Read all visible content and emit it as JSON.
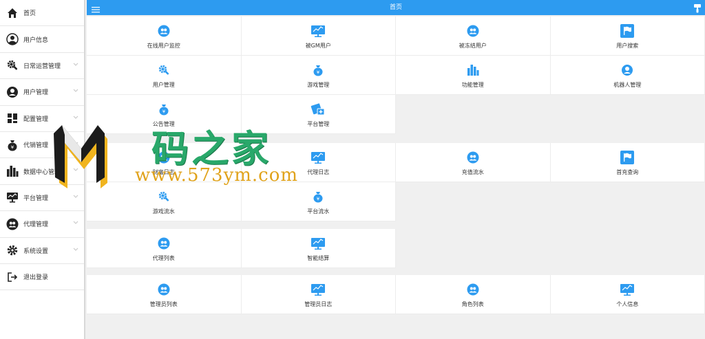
{
  "colors": {
    "accent": "#2d9bf0",
    "icon": "#2d9bf0",
    "watermark_green": "#29a86a",
    "watermark_gold": "#e0a21a"
  },
  "sidebar": {
    "items": [
      {
        "label": "首页",
        "icon": "home-icon",
        "has_arrow": false
      },
      {
        "label": "用户信息",
        "icon": "user-circle-icon",
        "has_arrow": false
      },
      {
        "label": "日常运营管理",
        "icon": "gear-wrench-icon",
        "has_arrow": true
      },
      {
        "label": "用户管理",
        "icon": "user-icon",
        "has_arrow": true
      },
      {
        "label": "配置管理",
        "icon": "grid-icon",
        "has_arrow": true
      },
      {
        "label": "代销管理",
        "icon": "money-bag-icon",
        "has_arrow": true
      },
      {
        "label": "数据中心管理",
        "icon": "bar-chart-icon",
        "has_arrow": true
      },
      {
        "label": "平台管理",
        "icon": "monitor-icon",
        "has_arrow": true
      },
      {
        "label": "代理管理",
        "icon": "users-icon",
        "has_arrow": true
      },
      {
        "label": "系统设置",
        "icon": "gear-icon",
        "has_arrow": true
      },
      {
        "label": "退出登录",
        "icon": "logout-icon",
        "has_arrow": false
      }
    ]
  },
  "header": {
    "title": "首页",
    "menu_icon": "hamburger-icon",
    "right_icon": "brush-icon"
  },
  "panels": [
    {
      "tiles": [
        {
          "label": "在线用户监控",
          "icon": "users-icon"
        },
        {
          "label": "被GM用户",
          "icon": "chart-icon"
        },
        {
          "label": "被冻结用户",
          "icon": "users-icon"
        },
        {
          "label": "用户搜索",
          "icon": "flag-icon"
        },
        {
          "label": "用户管理",
          "icon": "gear-wrench-icon"
        },
        {
          "label": "游戏管理",
          "icon": "money-bag-icon"
        },
        {
          "label": "功能管理",
          "icon": "bar-chart-icon"
        },
        {
          "label": "机器人管理",
          "icon": "user-icon"
        },
        {
          "label": "公告管理",
          "icon": "money-bag-icon"
        },
        {
          "label": "平台管理",
          "icon": "card-icon"
        }
      ]
    },
    {
      "tiles": [
        {
          "label": "财富日志",
          "icon": "users-icon"
        },
        {
          "label": "代理日志",
          "icon": "chart-icon"
        },
        {
          "label": "充值流水",
          "icon": "users-icon"
        },
        {
          "label": "首充查询",
          "icon": "flag-icon"
        },
        {
          "label": "游戏流水",
          "icon": "gear-wrench-icon"
        },
        {
          "label": "平台流水",
          "icon": "money-bag-icon"
        }
      ]
    },
    {
      "tiles": [
        {
          "label": "代理列表",
          "icon": "users-icon"
        },
        {
          "label": "智能结算",
          "icon": "chart-icon"
        }
      ]
    },
    {
      "tiles": [
        {
          "label": "管理员列表",
          "icon": "users-icon"
        },
        {
          "label": "管理员日志",
          "icon": "chart-icon"
        },
        {
          "label": "角色列表",
          "icon": "users-icon"
        },
        {
          "label": "个人信息",
          "icon": "chart-icon"
        }
      ]
    }
  ],
  "watermark": {
    "name": "码之家",
    "url": "www.573ym.com",
    "logo_icon": "m-logo"
  }
}
